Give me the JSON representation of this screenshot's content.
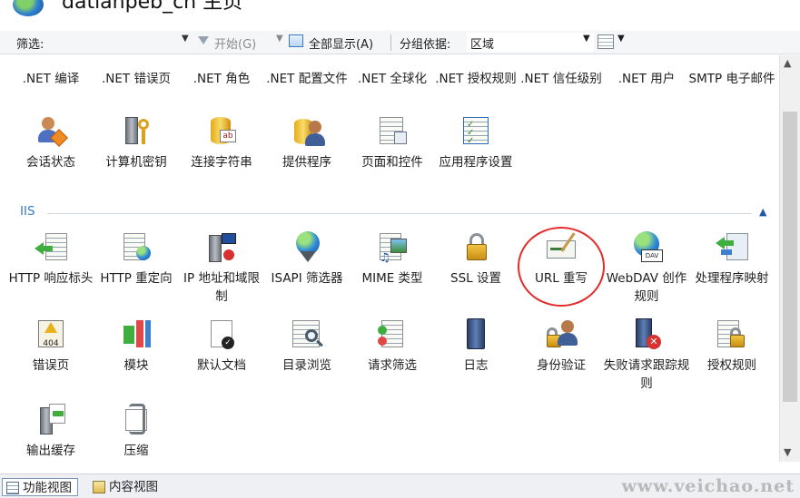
{
  "window": {
    "title": "datianpeb_cn 主页"
  },
  "filterbar": {
    "filter_label": "筛选:",
    "filter_value": "",
    "start_label": "开始(G)",
    "showall_label": "全部显示(A)",
    "group_label": "分组依据:",
    "group_value": "区域"
  },
  "aspnet": {
    "row1": [
      {
        "label": ".NET 编译"
      },
      {
        "label": ".NET 错误页"
      },
      {
        "label": ".NET 角色"
      },
      {
        "label": ".NET 配置文件"
      },
      {
        "label": ".NET 全球化"
      },
      {
        "label": ".NET 授权规则"
      },
      {
        "label": ".NET 信任级别"
      },
      {
        "label": ".NET 用户"
      },
      {
        "label": "SMTP 电子邮件"
      }
    ],
    "row2": [
      {
        "label": "会话状态",
        "icon": "session-state-icon"
      },
      {
        "label": "计算机密钥",
        "icon": "machine-key-icon"
      },
      {
        "label": "连接字符串",
        "icon": "connection-strings-icon"
      },
      {
        "label": "提供程序",
        "icon": "providers-icon"
      },
      {
        "label": "页面和控件",
        "icon": "pages-controls-icon"
      },
      {
        "label": "应用程序设置",
        "icon": "app-settings-icon"
      }
    ]
  },
  "iis": {
    "title": "IIS",
    "row1": [
      {
        "label": "HTTP 响应标头",
        "icon": "http-response-headers-icon"
      },
      {
        "label": "HTTP 重定向",
        "icon": "http-redirect-icon"
      },
      {
        "label": "IP 地址和域限制",
        "icon": "ip-domain-restrictions-icon"
      },
      {
        "label": "ISAPI 筛选器",
        "icon": "isapi-filters-icon"
      },
      {
        "label": "MIME 类型",
        "icon": "mime-types-icon"
      },
      {
        "label": "SSL 设置",
        "icon": "ssl-settings-icon"
      },
      {
        "label": "URL 重写",
        "icon": "url-rewrite-icon"
      },
      {
        "label": "WebDAV 创作规则",
        "icon": "webdav-icon"
      },
      {
        "label": "处理程序映射",
        "icon": "handler-mappings-icon"
      }
    ],
    "row2": [
      {
        "label": "错误页",
        "icon": "error-pages-icon",
        "badge": "404"
      },
      {
        "label": "模块",
        "icon": "modules-icon"
      },
      {
        "label": "默认文档",
        "icon": "default-document-icon"
      },
      {
        "label": "目录浏览",
        "icon": "directory-browsing-icon"
      },
      {
        "label": "请求筛选",
        "icon": "request-filtering-icon"
      },
      {
        "label": "日志",
        "icon": "logging-icon"
      },
      {
        "label": "身份验证",
        "icon": "authentication-icon"
      },
      {
        "label": "失败请求跟踪规则",
        "icon": "failed-request-tracing-icon"
      },
      {
        "label": "授权规则",
        "icon": "authorization-rules-icon"
      }
    ],
    "row3": [
      {
        "label": "输出缓存",
        "icon": "output-caching-icon"
      },
      {
        "label": "压缩",
        "icon": "compression-icon"
      }
    ]
  },
  "tabs": {
    "feature_view": "功能视图",
    "content_view": "内容视图"
  },
  "watermark": "www.veichao.net",
  "colors": {
    "accent": "#3a78c8",
    "highlight": "#e32b2b"
  }
}
